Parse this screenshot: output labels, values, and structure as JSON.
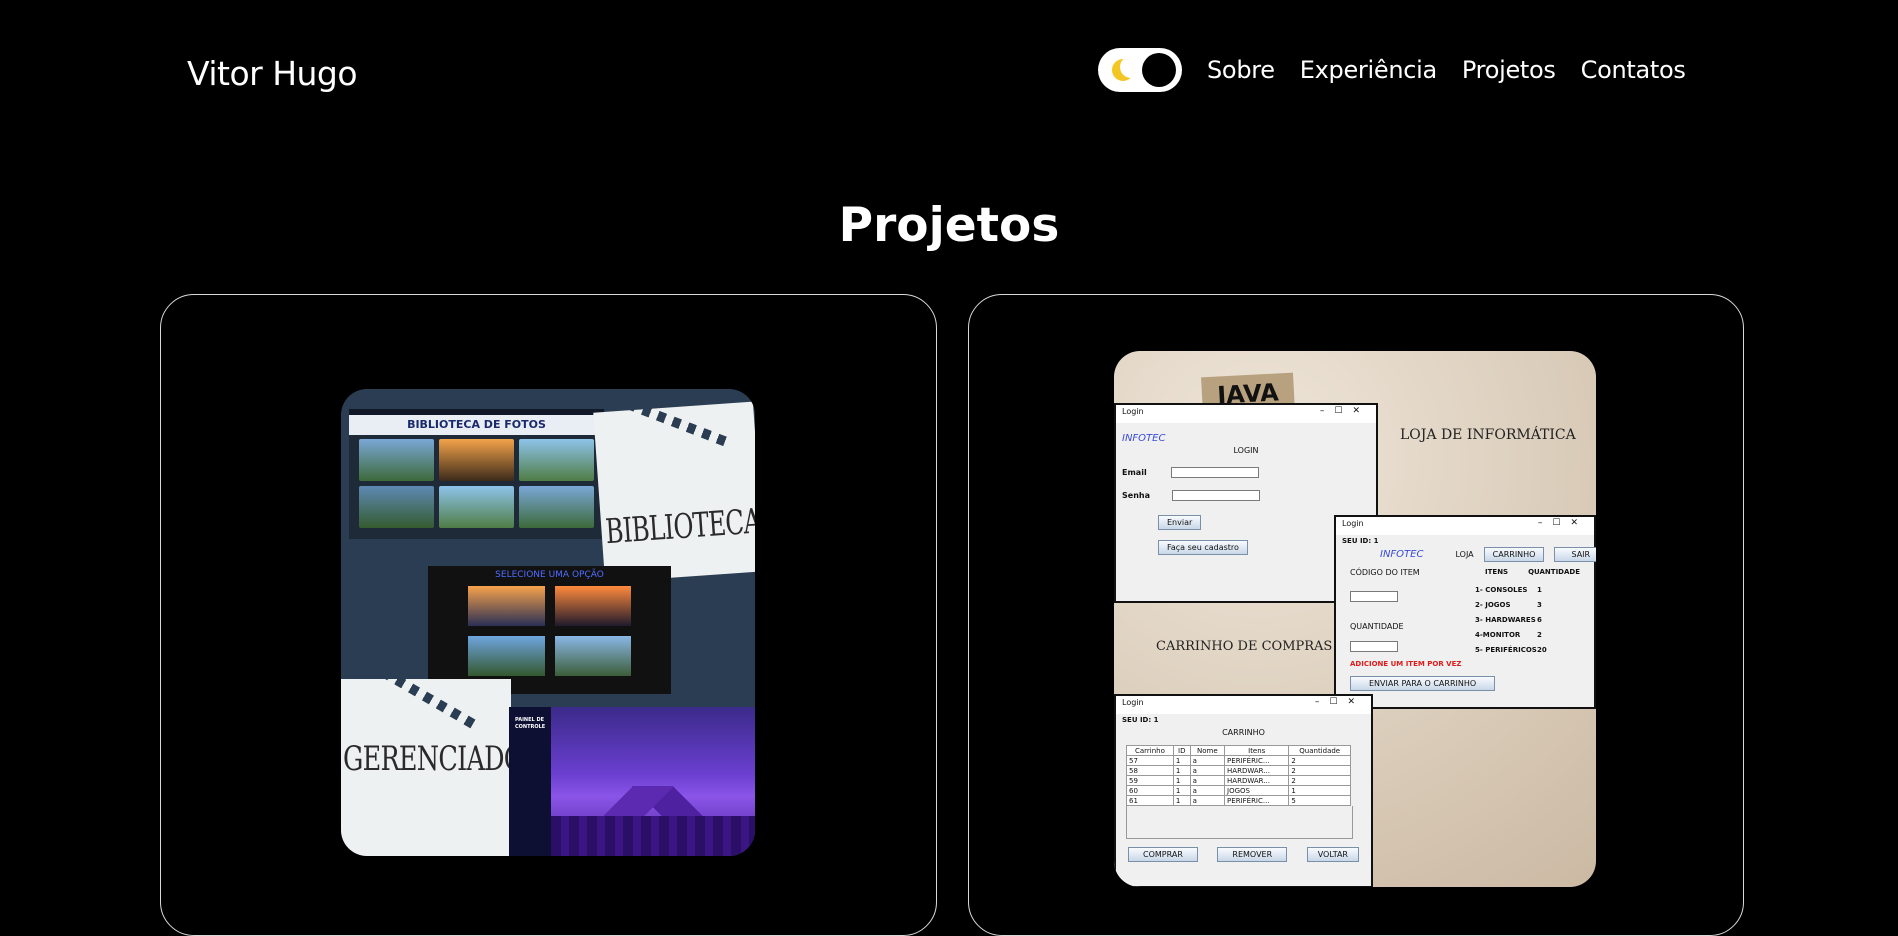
{
  "brand": "Vitor Hugo",
  "nav": {
    "links": [
      "Sobre",
      "Experiência",
      "Projetos",
      "Contatos"
    ]
  },
  "section_title": "Projetos",
  "project1": {
    "top_title": "BIBLIOTECA DE FOTOS",
    "mid_title": "SELECIONE UMA OPÇÃO",
    "label_top": "BIBLIOTECA",
    "label_bottom": "GERENCIADOR",
    "panel_title": "PAINEL DE CONTROLE"
  },
  "project2": {
    "tag": "JAVA",
    "store_label": "LOJA DE INFORMÁTICA",
    "cart_label": "CARRINHO DE COMPRAS",
    "login_win": {
      "title": "Login",
      "brand": "INFOTEC",
      "heading": "LOGIN",
      "email": "Email",
      "senha": "Senha",
      "btn_enviar": "Enviar",
      "btn_cadastro": "Faça seu cadastro"
    },
    "loja_win": {
      "title": "Login",
      "seu_id": "SEU ID: 1",
      "brand": "INFOTEC",
      "loja": "LOJA",
      "btn_carrinho": "CARRINHO",
      "btn_sair": "SAIR",
      "codigo": "CÓDIGO DO ITEM",
      "itens": "ITENS",
      "quantidade_hdr": "QUANTIDADE",
      "quantidade": "QUANTIDADE",
      "aviso": "ADICIONE UM ITEM POR VEZ",
      "btn_enviar": "ENVIAR PARA O CARRINHO",
      "items": [
        {
          "name": "1- CONSOLES",
          "qty": "1"
        },
        {
          "name": "2- JOGOS",
          "qty": "3"
        },
        {
          "name": "3- HARDWARES",
          "qty": "6"
        },
        {
          "name": "4-MONITOR",
          "qty": "2"
        },
        {
          "name": "5- PERIFÉRICOS",
          "qty": "20"
        }
      ]
    },
    "carrinho_win": {
      "title": "Login",
      "seu_id": "SEU ID: 1",
      "heading": "CARRINHO",
      "columns": [
        "Carrinho",
        "ID",
        "Nome",
        "Itens",
        "Quantidade"
      ],
      "rows": [
        [
          "57",
          "1",
          "a",
          "PERIFÉRIC...",
          "2"
        ],
        [
          "58",
          "1",
          "a",
          "HARDWAR...",
          "2"
        ],
        [
          "59",
          "1",
          "a",
          "HARDWAR...",
          "2"
        ],
        [
          "60",
          "1",
          "a",
          "JOGOS",
          "1"
        ],
        [
          "61",
          "1",
          "a",
          "PERIFÉRIC...",
          "5"
        ]
      ],
      "btn_comprar": "COMPRAR",
      "btn_remover": "REMOVER",
      "btn_voltar": "VOLTAR"
    }
  },
  "colors": {
    "background": "#000000",
    "accent_moon": "#f3c623",
    "card_border": "#d9d9d9"
  },
  "icons": {
    "theme_toggle": "moon-icon"
  }
}
